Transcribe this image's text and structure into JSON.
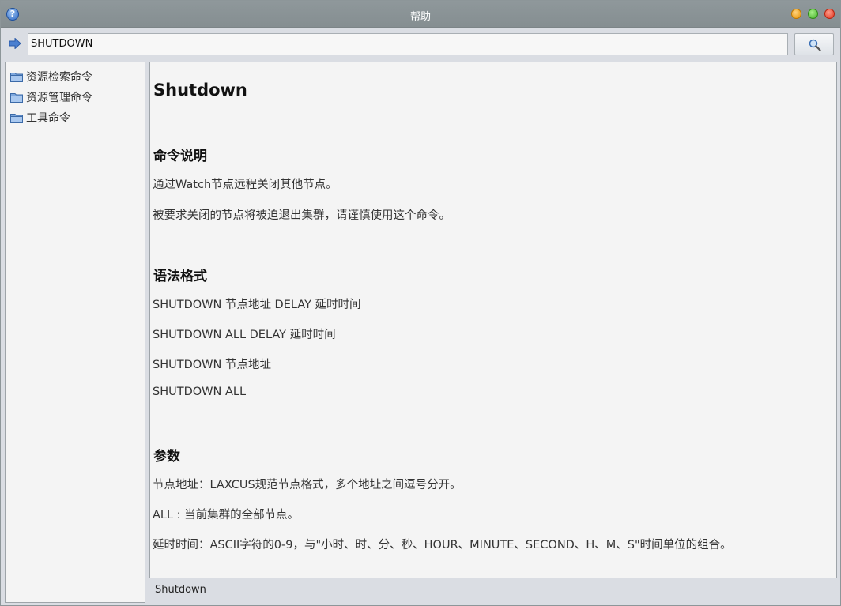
{
  "window": {
    "title": "帮助"
  },
  "search": {
    "value": "SHUTDOWN"
  },
  "tree": {
    "items": [
      {
        "label": "资源检索命令"
      },
      {
        "label": "资源管理命令"
      },
      {
        "label": "工具命令"
      }
    ]
  },
  "doc": {
    "title": "Shutdown",
    "sections": [
      {
        "heading": "命令说明",
        "lines": [
          "通过Watch节点远程关闭其他节点。",
          "被要求关闭的节点将被迫退出集群，请谨慎使用这个命令。"
        ]
      },
      {
        "heading": "语法格式",
        "lines": [
          "SHUTDOWN 节点地址 DELAY 延时时间",
          "SHUTDOWN ALL DELAY 延时时间",
          "SHUTDOWN 节点地址",
          "SHUTDOWN ALL"
        ]
      },
      {
        "heading": "参数",
        "lines": [
          "节点地址：LAXCUS规范节点格式，多个地址之间逗号分开。",
          "ALL : 当前集群的全部节点。",
          "延时时间：ASCII字符的0-9，与\"小时、时、分、秒、HOUR、MINUTE、SECOND、H、M、S\"时间单位的组合。"
        ]
      }
    ]
  },
  "status": {
    "text": "Shutdown"
  },
  "icons": {
    "help": "help-icon",
    "arrow": "arrow-right-icon",
    "search": "search-icon",
    "folder": "folder-icon"
  }
}
